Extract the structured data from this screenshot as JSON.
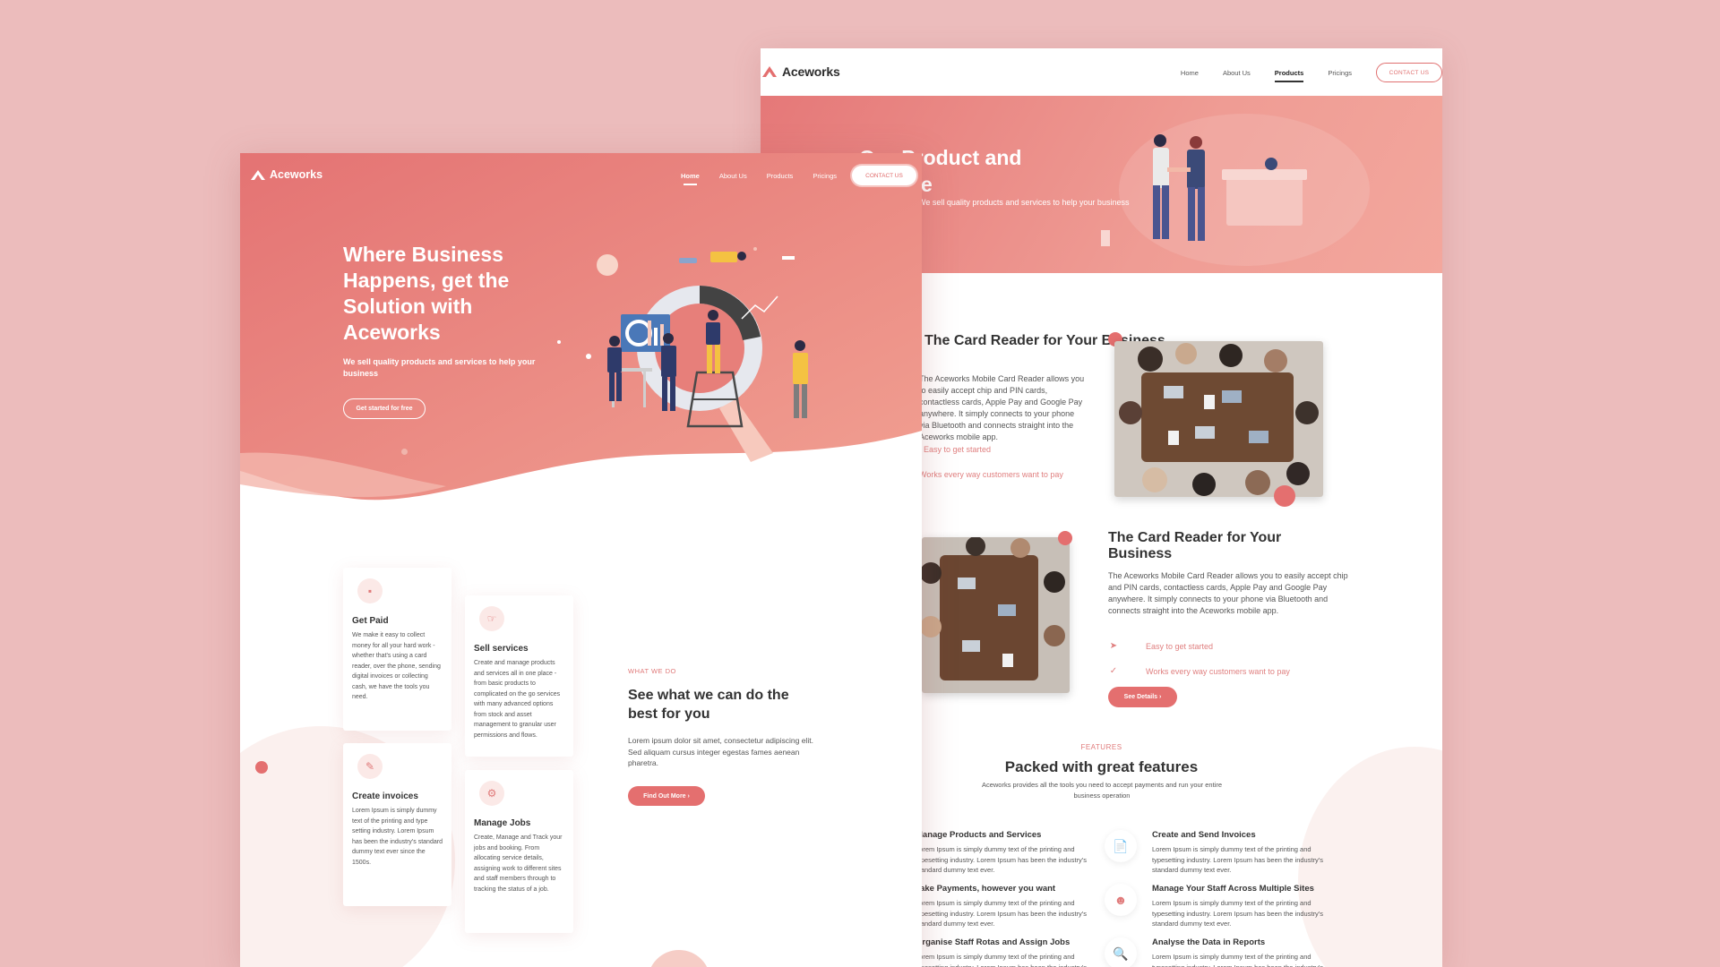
{
  "products_page": {
    "brand": "Aceworks",
    "nav": [
      "Home",
      "About Us",
      "Products",
      "Pricings"
    ],
    "active_nav": "Products",
    "contact_label": "CONTACT US",
    "hero_title_line1": "Our Product and",
    "hero_title_line2": "Service",
    "hero_subtitle": "We sell quality products and services to help your business",
    "section1": {
      "title": "The Card Reader for Your Business",
      "text": "The Aceworks Mobile Card Reader allows you to easily accept chip and PIN cards, contactless cards, Apple Pay and Google Pay anywhere. It simply connects to your phone via Bluetooth and connects straight into the Aceworks mobile app.",
      "link1": "Easy to get started",
      "link2": "Works every way customers want to pay"
    },
    "section2": {
      "title": "The Card Reader for Your Business",
      "text": "The Aceworks Mobile Card Reader allows you to easily accept chip and PIN cards, contactless cards, Apple Pay and Google Pay anywhere. It simply connects to your phone via Bluetooth and connects straight into the Aceworks mobile app.",
      "point1": "Easy to get started",
      "point2": "Works every way customers want to pay",
      "button": "See Details ›"
    },
    "features": {
      "eyebrow": "FEATURES",
      "title": "Packed with great features",
      "subtitle": "Aceworks provides all the tools you need to accept payments and run your entire business operation",
      "items": [
        {
          "title": "Manage Products and Services",
          "text": "Lorem Ipsum is simply dummy text of the printing and typesetting industry. Lorem Ipsum has been the industry's standard dummy text ever."
        },
        {
          "title": "Create and Send Invoices",
          "text": "Lorem Ipsum is simply dummy text of the printing and typesetting industry. Lorem Ipsum has been the industry's standard dummy text ever."
        },
        {
          "title": "Take Payments, however you want",
          "text": "Lorem Ipsum is simply dummy text of the printing and typesetting industry. Lorem Ipsum has been the industry's standard dummy text ever."
        },
        {
          "title": "Manage Your Staff Across Multiple Sites",
          "text": "Lorem Ipsum is simply dummy text of the printing and typesetting industry. Lorem Ipsum has been the industry's standard dummy text ever."
        },
        {
          "title": "Organise Staff Rotas and Assign Jobs",
          "text": "Lorem Ipsum is simply dummy text of the printing and typesetting industry. Lorem Ipsum has been the industry's standard dummy text ever."
        },
        {
          "title": "Analyse the Data in Reports",
          "text": "Lorem Ipsum is simply dummy text of the printing and typesetting industry. Lorem Ipsum has been the industry's standard dummy text ever."
        }
      ]
    }
  },
  "home_page": {
    "brand": "Aceworks",
    "nav": [
      "Home",
      "About Us",
      "Products",
      "Pricings"
    ],
    "active_nav": "Home",
    "contact_label": "CONTACT US",
    "hero_title": "Where Business Happens, get the Solution with Aceworks",
    "hero_subtitle": "We sell quality products and services to help your business",
    "hero_cta": "Get started for free",
    "cards": [
      {
        "title": "Get Paid",
        "text": "We make it easy to collect money for all your hard work - whether that's using a card reader, over the phone, sending digital invoices or collecting cash, we have the tools you need."
      },
      {
        "title": "Sell services",
        "text": "Create and manage products and services all in one place - from basic products to complicated on the go services with many advanced options from stock and asset management to granular user permissions and flows."
      },
      {
        "title": "Create invoices",
        "text": "Lorem Ipsum is simply dummy text of the printing and type setting industry. Lorem Ipsum has been the industry's standard dummy text ever since the 1500s."
      },
      {
        "title": "Manage Jobs",
        "text": "Create, Manage and Track your jobs and booking. From allocating service details, assigning work to different sites and staff members through to tracking the status of a job."
      }
    ],
    "about": {
      "eyebrow": "WHAT WE DO",
      "title": "See what we can do the best for you",
      "text": "Lorem ipsum dolor sit amet, consectetur adipiscing elit. Sed aliquam cursus integer egestas fames aenean pharetra.",
      "button": "Find Out More ›"
    }
  },
  "colors": {
    "background": "#ecbcbc",
    "accent": "#e46f6f",
    "hero_start": "#e57878",
    "hero_end": "#f3a79d"
  }
}
